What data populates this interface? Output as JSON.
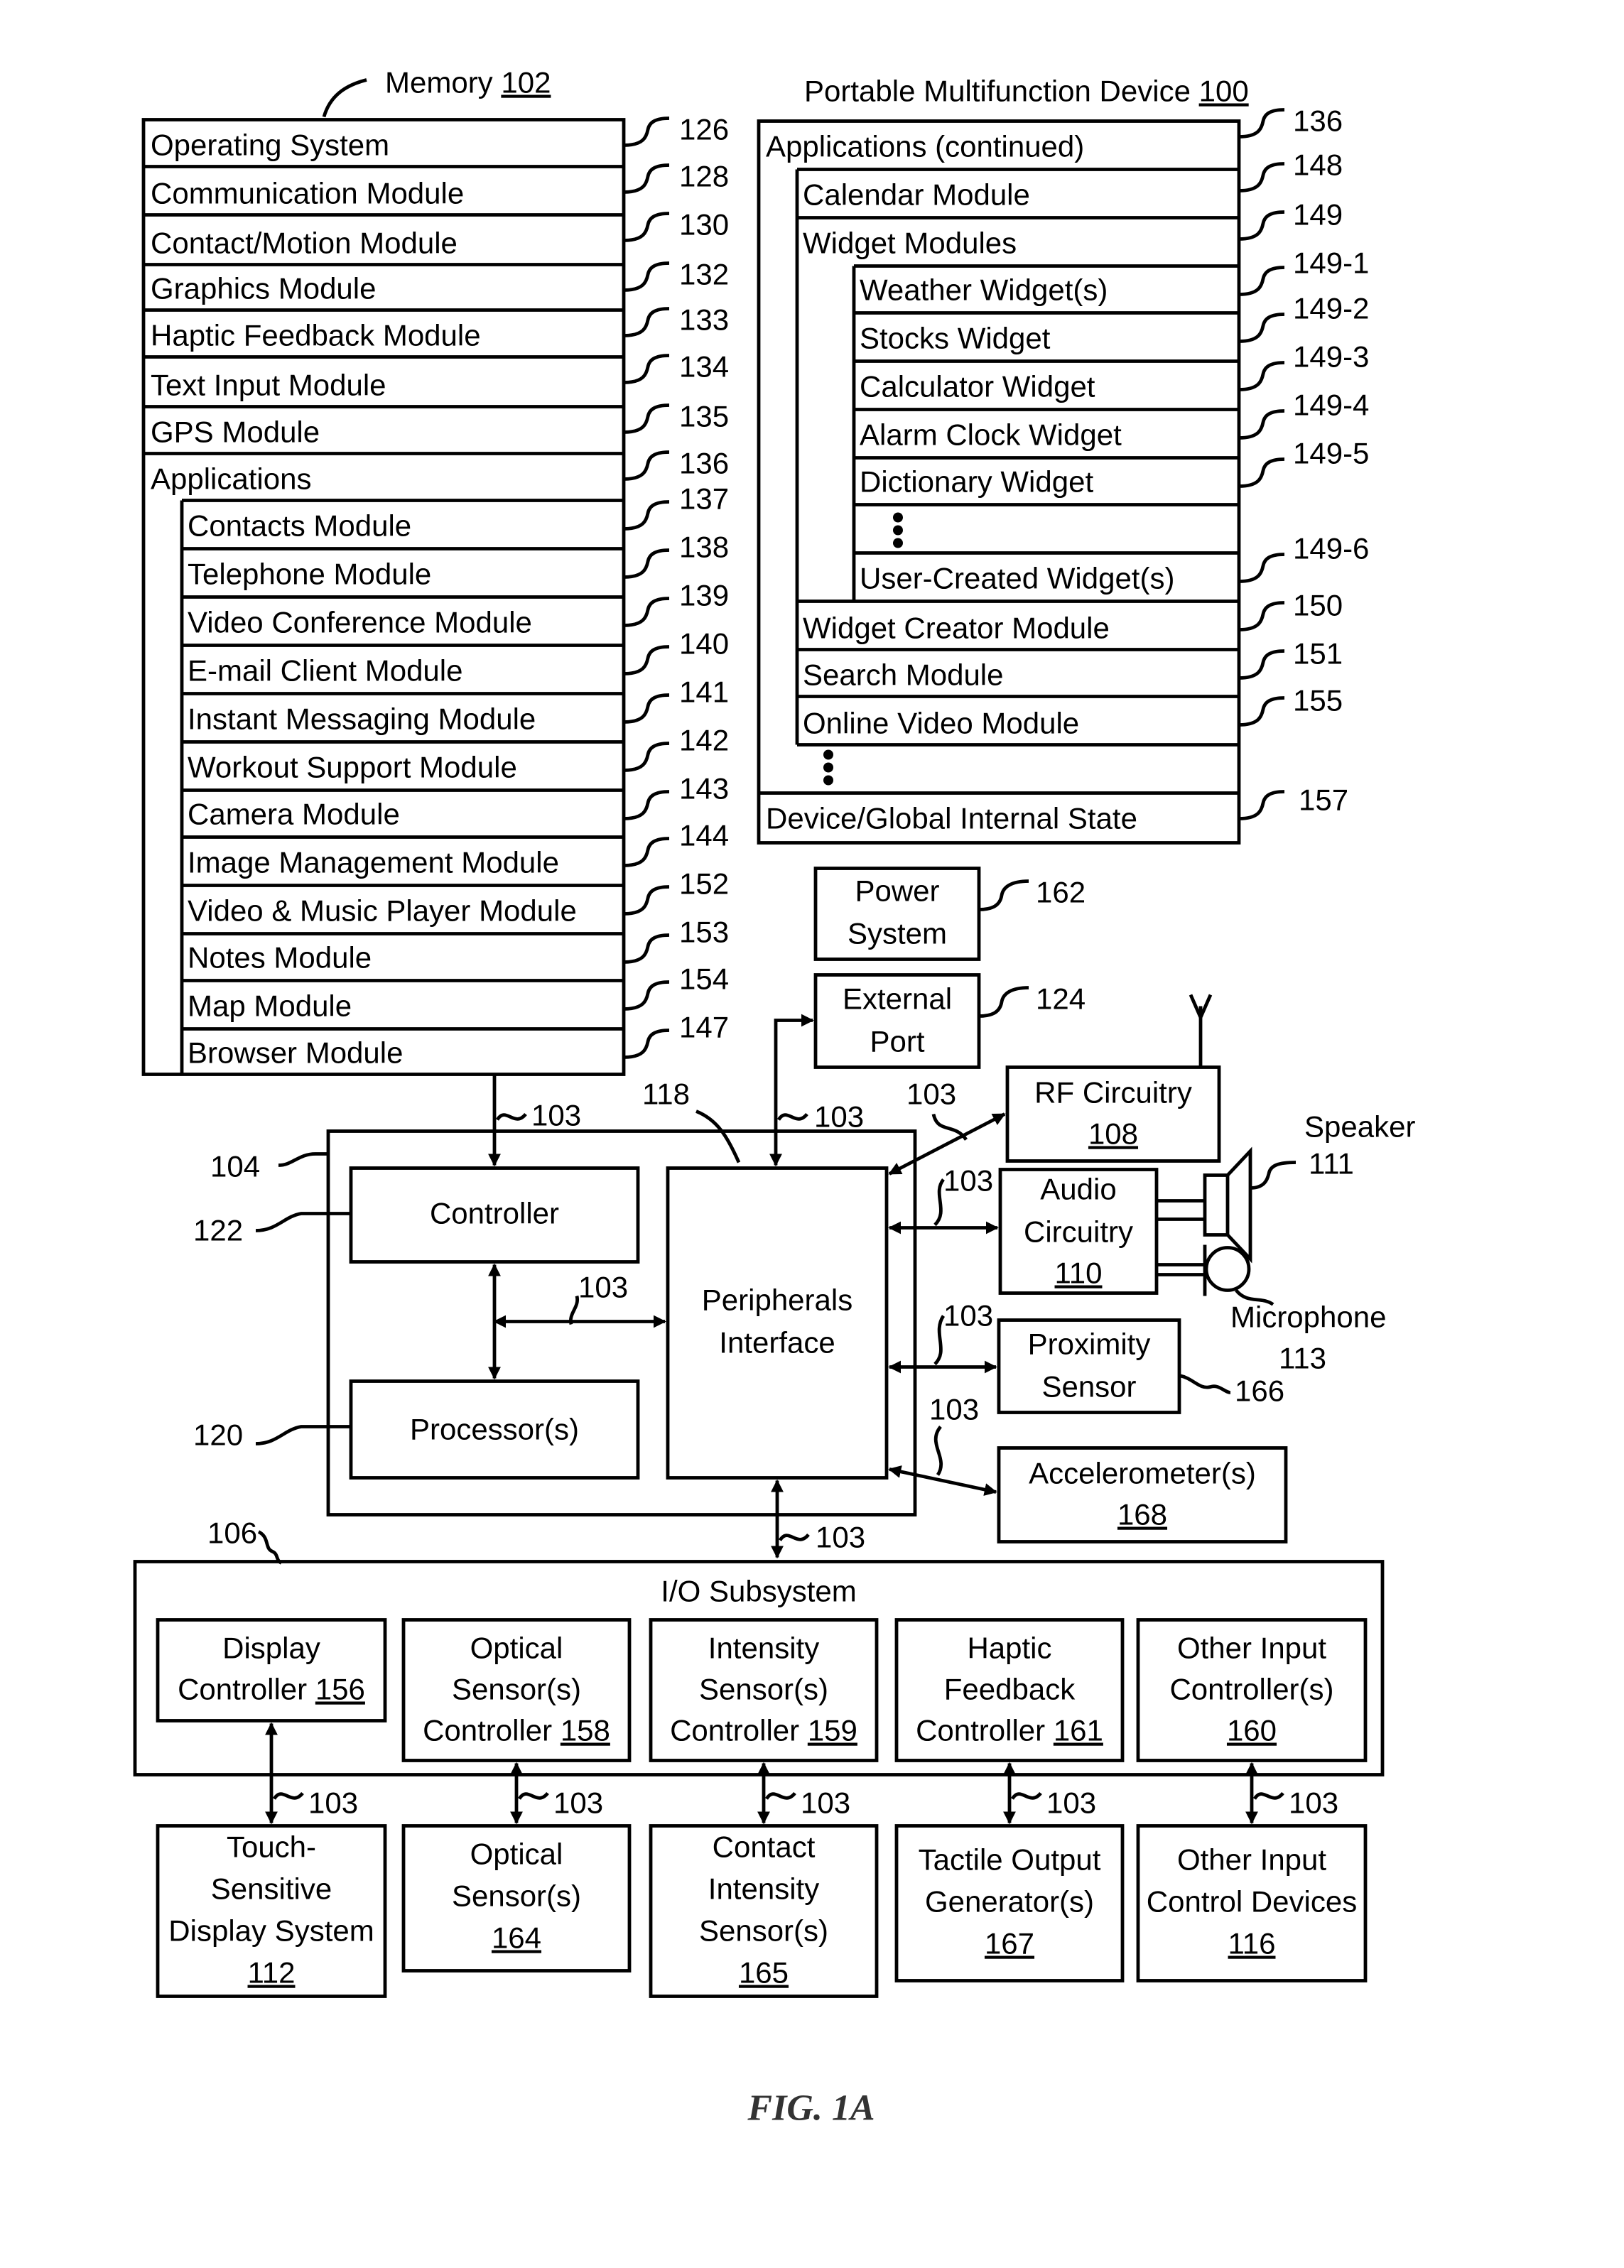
{
  "figure_label": "FIG. 1A",
  "memory": {
    "title": "Memory",
    "ref": "102",
    "rows": [
      {
        "label": "Operating System",
        "ref": "126"
      },
      {
        "label": "Communication Module",
        "ref": "128"
      },
      {
        "label": "Contact/Motion Module",
        "ref": "130"
      },
      {
        "label": "Graphics Module",
        "ref": "132"
      },
      {
        "label": "Haptic Feedback Module",
        "ref": "133"
      },
      {
        "label": "Text Input Module",
        "ref": "134"
      },
      {
        "label": "GPS Module",
        "ref": "135"
      },
      {
        "label": "Applications",
        "ref": "136"
      }
    ],
    "applications": [
      {
        "label": "Contacts Module",
        "ref": "137"
      },
      {
        "label": "Telephone Module",
        "ref": "138"
      },
      {
        "label": "Video Conference Module",
        "ref": "139"
      },
      {
        "label": "E-mail Client Module",
        "ref": "140"
      },
      {
        "label": "Instant Messaging Module",
        "ref": "141"
      },
      {
        "label": "Workout Support Module",
        "ref": "142"
      },
      {
        "label": "Camera Module",
        "ref": "143"
      },
      {
        "label": "Image Management Module",
        "ref": "144"
      },
      {
        "label": "Video & Music Player Module",
        "ref": "152"
      },
      {
        "label": "Notes Module",
        "ref": "153"
      },
      {
        "label": "Map Module",
        "ref": "154"
      },
      {
        "label": "Browser Module",
        "ref": "147"
      }
    ]
  },
  "device": {
    "title": "Portable Multifunction Device",
    "ref": "100",
    "apps_continued": {
      "label": "Applications (continued)",
      "ref": "136"
    },
    "calendar": {
      "label": "Calendar Module",
      "ref": "148"
    },
    "widget_modules": {
      "label": "Widget Modules",
      "ref": "149"
    },
    "widgets": [
      {
        "label": "Weather Widget(s)",
        "ref": "149-1"
      },
      {
        "label": "Stocks Widget",
        "ref": "149-2"
      },
      {
        "label": "Calculator Widget",
        "ref": "149-3"
      },
      {
        "label": "Alarm Clock Widget",
        "ref": "149-4"
      },
      {
        "label": "Dictionary Widget",
        "ref": "149-5"
      },
      {
        "label": "",
        "ref": ""
      },
      {
        "label": "User-Created Widget(s)",
        "ref": "149-6"
      }
    ],
    "after_widgets": [
      {
        "label": "Widget Creator Module",
        "ref": "150"
      },
      {
        "label": "Search Module",
        "ref": "151"
      },
      {
        "label": "Online Video Module",
        "ref": "155"
      }
    ],
    "state": {
      "label": "Device/Global Internal State",
      "ref": "157"
    }
  },
  "power": {
    "lines": [
      "Power",
      "System"
    ],
    "ref": "162"
  },
  "external_port": {
    "lines": [
      "External",
      "Port"
    ],
    "ref": "124"
  },
  "rf": {
    "lines": [
      "RF Circuitry"
    ],
    "num": "108"
  },
  "audio": {
    "lines": [
      "Audio",
      "Circuitry"
    ],
    "num": "110"
  },
  "speaker": {
    "label": "Speaker",
    "ref": "111"
  },
  "microphone": {
    "label": "Microphone",
    "ref": "113"
  },
  "proximity": {
    "lines": [
      "Proximity",
      "Sensor"
    ],
    "ref": "166"
  },
  "accelerometer": {
    "lines": [
      "Accelerometer(s)"
    ],
    "num": "168"
  },
  "controller": {
    "label": "Controller",
    "ref": "122"
  },
  "processor": {
    "label": "Processor(s)",
    "ref": "120"
  },
  "peripherals": {
    "lines": [
      "Peripherals",
      "Interface"
    ],
    "ref": "118"
  },
  "chip_ref": "104",
  "bus_ref": "103",
  "io": {
    "title": "I/O Subsystem",
    "ref": "106",
    "controllers": [
      {
        "lines": [
          "Display",
          "Controller"
        ],
        "num": "156",
        "inline": true
      },
      {
        "lines": [
          "Optical",
          "Sensor(s)",
          "Controller"
        ],
        "num": "158",
        "inline": true
      },
      {
        "lines": [
          "Intensity",
          "Sensor(s)",
          "Controller"
        ],
        "num": "159",
        "inline": true
      },
      {
        "lines": [
          "Haptic",
          "Feedback",
          "Controller"
        ],
        "num": "161",
        "inline": true
      },
      {
        "lines": [
          "Other Input",
          "Controller(s)"
        ],
        "num": "160",
        "inline": false
      }
    ],
    "devices": [
      {
        "lines": [
          "Touch-",
          "Sensitive",
          "Display System"
        ],
        "num": "112"
      },
      {
        "lines": [
          "Optical",
          "Sensor(s)"
        ],
        "num": "164"
      },
      {
        "lines": [
          "Contact",
          "Intensity",
          "Sensor(s)"
        ],
        "num": "165"
      },
      {
        "lines": [
          "Tactile Output",
          "Generator(s)"
        ],
        "num": "167"
      },
      {
        "lines": [
          "Other Input",
          "Control Devices"
        ],
        "num": "116"
      }
    ]
  }
}
